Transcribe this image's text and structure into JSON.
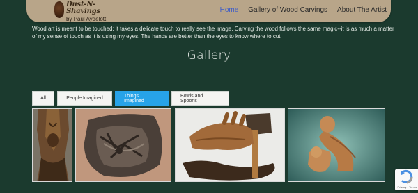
{
  "header": {
    "logo": {
      "title": "Dust-N-Shavings",
      "subtitle": "by Paul Aydelott"
    },
    "nav": [
      {
        "label": "Home",
        "active": true
      },
      {
        "label": "Gallery of Wood Carvings",
        "active": false
      },
      {
        "label": "About The Artist",
        "active": false
      }
    ]
  },
  "intro": "Wood art is meant to be touched; it takes a delicate touch to really see the image. Carving the wood follows the same magic--it is as much a matter of my sense of touch as it is using my eyes. The hands are better than the eyes to know where to cut.",
  "gallery": {
    "title": "Gallery",
    "filters": [
      {
        "label": "All",
        "active": false
      },
      {
        "label": "People Imagined",
        "active": false
      },
      {
        "label": "Things Imagined",
        "active": true
      },
      {
        "label": "Bowls and Spoons",
        "active": false
      }
    ]
  },
  "recaptcha": {
    "label": "Privacy - Terms"
  },
  "colors": {
    "background": "#1b3a2e",
    "header": "#b8a589",
    "nav_active": "#3d5cc9",
    "filter_active": "#27a3e8"
  },
  "icons": {
    "back_to_top": "chevron-up-icon"
  }
}
